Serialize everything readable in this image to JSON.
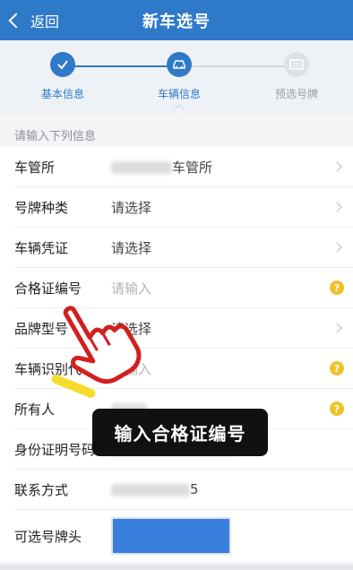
{
  "header": {
    "back_label": "返回",
    "title": "新车选号"
  },
  "steps": [
    {
      "label": "基本信息",
      "state": "done"
    },
    {
      "label": "车辆信息",
      "state": "current"
    },
    {
      "label": "预选号牌",
      "state": "pending"
    }
  ],
  "colors": {
    "brand": "#2f79c9",
    "active": "#2f79c9",
    "pending": "#c7ccd2",
    "help": "#f0c12a",
    "plate_box": "#3b7fde"
  },
  "form": {
    "hint": "请输入下列信息",
    "rows": [
      {
        "label": "车管所",
        "value": "车管所",
        "type": "select"
      },
      {
        "label": "号牌种类",
        "value": "请选择",
        "type": "select"
      },
      {
        "label": "车辆凭证",
        "value": "请选择",
        "type": "select"
      },
      {
        "label": "合格证编号",
        "placeholder": "请输入",
        "type": "input"
      },
      {
        "label": "品牌型号",
        "value": "请选择",
        "type": "select"
      },
      {
        "label": "车辆识别代号",
        "placeholder": "请输入",
        "type": "input"
      },
      {
        "label": "所有人",
        "value": "",
        "type": "text"
      },
      {
        "label": "身份证明号码",
        "value": "",
        "type": "text"
      },
      {
        "label": "联系方式",
        "value": "5",
        "type": "text"
      },
      {
        "label": "可选号牌头",
        "type": "plate"
      }
    ]
  },
  "help_mark": "?",
  "overlay": {
    "caption": "输入合格证编号",
    "icon": "pointing-hand-icon"
  }
}
